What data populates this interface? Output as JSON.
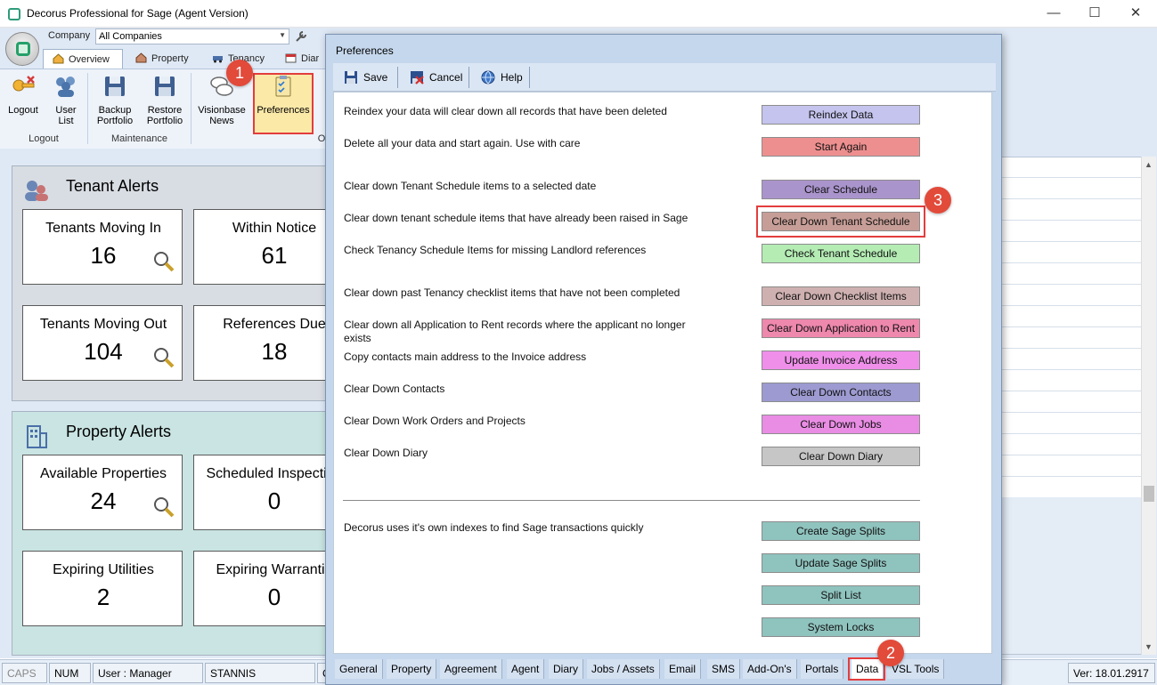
{
  "window": {
    "title": "Decorus Professional for Sage (Agent Version)",
    "controls": {
      "minimize": "—",
      "maximize": "☐",
      "close": "✕"
    }
  },
  "quick_access": {
    "company_label": "Company",
    "company_value": "All Companies"
  },
  "ribbon": {
    "tabs": [
      {
        "label": "Overview",
        "icon": "home-icon"
      },
      {
        "label": "Property",
        "icon": "house-icon"
      },
      {
        "label": "Tenancy",
        "icon": "car-icon"
      },
      {
        "label": "Diar",
        "icon": "calendar-icon"
      }
    ],
    "buttons": [
      {
        "label": "Logout",
        "icon": "key-icon"
      },
      {
        "label": "User\nList",
        "icon": "users-icon"
      },
      {
        "label": "Backup\nPortfolio",
        "icon": "disk-icon"
      },
      {
        "label": "Restore\nPortfolio",
        "icon": "disk-icon"
      },
      {
        "label": "Visionbase\nNews",
        "icon": "chat-icon"
      },
      {
        "label": "Preferences",
        "icon": "clipboard-icon"
      }
    ],
    "groups": {
      "logout": "Logout",
      "maintenance": "Maintenance",
      "other": "O"
    }
  },
  "callouts": {
    "one": "1",
    "two": "2",
    "three": "3"
  },
  "dashboard": {
    "tenant_alerts": {
      "title": "Tenant Alerts",
      "cards": [
        {
          "label": "Tenants Moving In",
          "value": "16"
        },
        {
          "label": "Within Notice",
          "value": "61"
        },
        {
          "label": "Tenants Moving Out",
          "value": "104"
        },
        {
          "label": "References Due",
          "value": "18"
        }
      ]
    },
    "property_alerts": {
      "title": "Property Alerts",
      "cards": [
        {
          "label": "Available Properties",
          "value": "24"
        },
        {
          "label": "Scheduled Inspection",
          "value": "0"
        },
        {
          "label": "Expiring Utilities",
          "value": "2"
        },
        {
          "label": "Expiring Warrantie",
          "value": "0"
        }
      ]
    }
  },
  "statusbar": {
    "caps": "CAPS",
    "num": "NUM",
    "user": "User : Manager",
    "machine": "STANNIS",
    "c": "C",
    "version": "Ver: 18.01.2917"
  },
  "dialog": {
    "title": "Preferences",
    "toolbar": {
      "save": "Save",
      "cancel": "Cancel",
      "help": "Help"
    },
    "rows": [
      {
        "text": "Reindex your data will clear down all records that have been deleted",
        "button": "Reindex Data",
        "color": "#c4c4ee"
      },
      {
        "text": "Delete all your data and start again. Use with care",
        "button": "Start Again",
        "color": "#ee8f8f"
      },
      {
        "text": "Clear down Tenant Schedule items to a selected date",
        "button": "Clear Schedule",
        "color": "#aa94cc"
      },
      {
        "text": "Clear down tenant schedule items that have already been raised in Sage",
        "button": "Clear Down Tenant Schedule",
        "color": "#c79e97"
      },
      {
        "text": "Check Tenancy Schedule Items for missing Landlord references",
        "button": "Check Tenant Schedule",
        "color": "#b4ecb4"
      },
      {
        "text": "Clear down past Tenancy checklist items that have not been completed",
        "button": "Clear Down Checklist Items",
        "color": "#cfb0b0"
      },
      {
        "text": "Clear down all Application to Rent records where the applicant no longer exists",
        "button": "Clear Down Application to Rent",
        "color": "#ee88ad"
      },
      {
        "text": "Copy contacts main address to the Invoice address",
        "button": "Update Invoice Address",
        "color": "#ef8fea"
      },
      {
        "text": "Clear Down Contacts",
        "button": "Clear Down Contacts",
        "color": "#9c9ad0"
      },
      {
        "text": "Clear Down Work Orders and Projects",
        "button": "Clear Down Jobs",
        "color": "#e98de4"
      },
      {
        "text": "Clear Down Diary",
        "button": "Clear Down Diary",
        "color": "#c6c6c6"
      },
      {
        "text": "Decorus uses it's own indexes to find Sage transactions quickly",
        "button": "Create Sage Splits",
        "color": "#8fc3be"
      },
      {
        "text": "",
        "button": "Update Sage Splits",
        "color": "#8fc3be"
      },
      {
        "text": "",
        "button": "Split List",
        "color": "#8fc3be"
      },
      {
        "text": "",
        "button": "System Locks",
        "color": "#8fc3be"
      }
    ],
    "tabs": [
      "General",
      "Property",
      "Agreement",
      "Agent",
      "Diary",
      "Jobs / Assets",
      "Email",
      "SMS",
      "Add-On's",
      "Portals",
      "Data",
      "VSL Tools"
    ],
    "active_tab": "Data"
  }
}
